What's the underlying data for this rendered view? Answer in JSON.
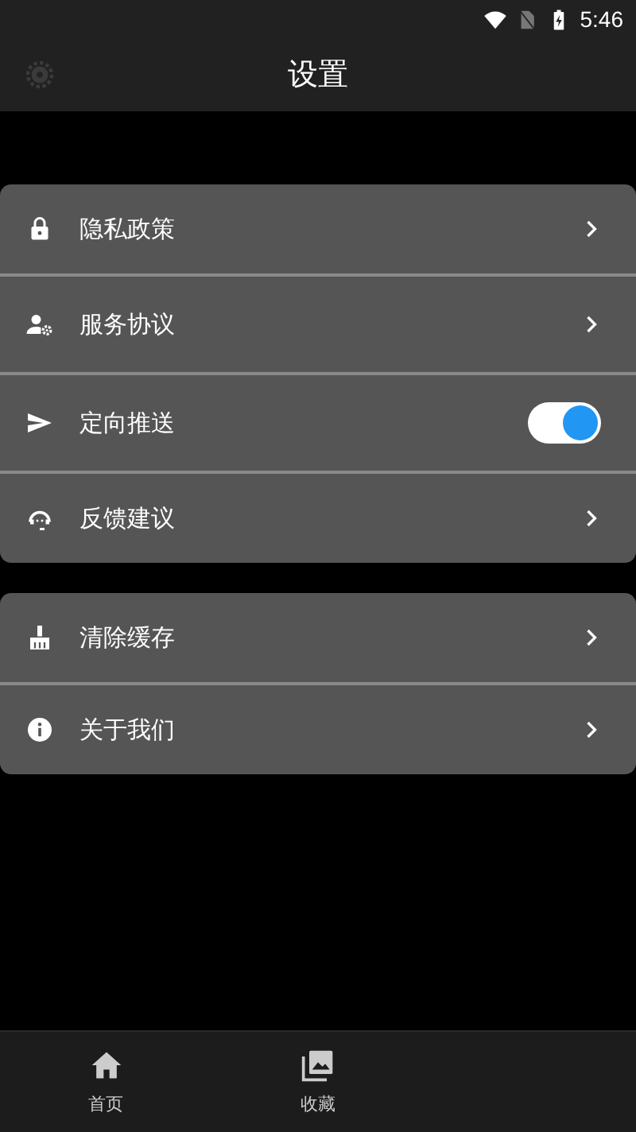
{
  "status_bar": {
    "time": "5:46"
  },
  "header": {
    "title": "设置"
  },
  "groups": [
    {
      "items": [
        {
          "kind": "link",
          "label": "隐私政策"
        },
        {
          "kind": "link",
          "label": "服务协议"
        },
        {
          "kind": "toggle",
          "label": "定向推送",
          "on": true
        },
        {
          "kind": "link",
          "label": "反馈建议"
        }
      ]
    },
    {
      "items": [
        {
          "kind": "link",
          "label": "清除缓存"
        },
        {
          "kind": "link",
          "label": "关于我们"
        }
      ]
    }
  ],
  "bottom_nav": [
    {
      "label": "首页",
      "selected": false
    },
    {
      "label": "收藏",
      "selected": false
    }
  ]
}
